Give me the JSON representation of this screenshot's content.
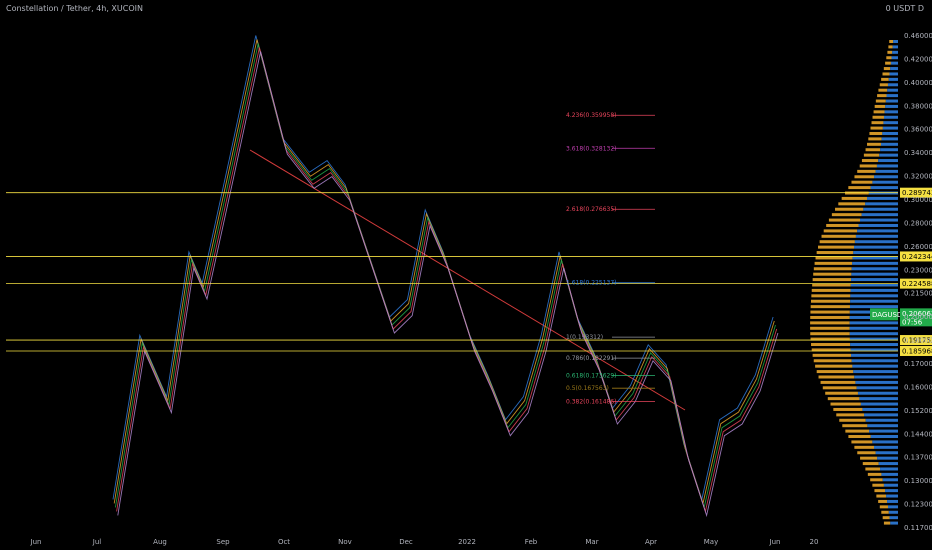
{
  "header": {
    "title": "Constellation / Tether, 4h, XUCOIN"
  },
  "price_axis_unit": "0 USDT D",
  "chart_data": {
    "type": "candlestick",
    "title": "Constellation / Tether, 4h, XUCOIN",
    "x_ticks": [
      "Jun",
      "Jul",
      "Aug",
      "Sep",
      "Oct",
      "Nov",
      "Dec",
      "2022",
      "Feb",
      "Mar",
      "Apr",
      "May",
      "Jun",
      "20"
    ],
    "y_ticks": [
      "0.460000",
      "0.420000",
      "0.400000",
      "0.380000",
      "0.360000",
      "0.340000",
      "0.320000",
      "0.300000",
      "0.280000",
      "0.260000",
      "0.230000",
      "0.215000",
      "0.200000",
      "0.180000",
      "0.170000",
      "0.160000",
      "0.152000",
      "0.144000",
      "0.137000",
      "0.130000",
      "0.123000",
      "0.117000"
    ],
    "y_range": [
      0.112,
      0.47
    ],
    "price_path": [
      [
        0.12,
        0.12
      ],
      [
        0.15,
        0.19
      ],
      [
        0.18,
        0.16
      ],
      [
        0.205,
        0.24
      ],
      [
        0.22,
        0.22
      ],
      [
        0.25,
        0.31
      ],
      [
        0.28,
        0.44
      ],
      [
        0.29,
        0.4
      ],
      [
        0.31,
        0.33
      ],
      [
        0.34,
        0.3
      ],
      [
        0.36,
        0.31
      ],
      [
        0.38,
        0.29
      ],
      [
        0.4,
        0.25
      ],
      [
        0.43,
        0.2
      ],
      [
        0.45,
        0.21
      ],
      [
        0.47,
        0.27
      ],
      [
        0.49,
        0.24
      ],
      [
        0.52,
        0.19
      ],
      [
        0.54,
        0.17
      ],
      [
        0.56,
        0.15
      ],
      [
        0.58,
        0.16
      ],
      [
        0.6,
        0.19
      ],
      [
        0.62,
        0.24
      ],
      [
        0.64,
        0.2
      ],
      [
        0.66,
        0.18
      ],
      [
        0.68,
        0.155
      ],
      [
        0.7,
        0.165
      ],
      [
        0.72,
        0.185
      ],
      [
        0.74,
        0.175
      ],
      [
        0.76,
        0.14
      ],
      [
        0.78,
        0.12
      ],
      [
        0.8,
        0.15
      ],
      [
        0.82,
        0.155
      ],
      [
        0.84,
        0.17
      ],
      [
        0.86,
        0.2
      ]
    ],
    "horizontal_levels": [
      {
        "price": 0.289743,
        "label": "0.289743",
        "color": "#f5e042"
      },
      {
        "price": 0.242344,
        "label": "0.242344",
        "color": "#f5e042"
      },
      {
        "price": 0.224588,
        "label": "0.224588",
        "color": "#f5e042"
      },
      {
        "price": 0.191752,
        "label": "0.191752",
        "color": "#f5e042"
      },
      {
        "price": 0.185968,
        "label": "0.185968",
        "color": "#f5e042"
      }
    ],
    "current_price": {
      "symbol": "DAGUSDT",
      "label": "0.206062",
      "countdown": "07:56",
      "price": 0.206062,
      "color": "#22ab4a"
    },
    "fib_levels": [
      {
        "label": "4.236(0.359958)",
        "price": 0.359958,
        "color": "#e8455c"
      },
      {
        "label": "3.618(0.328132)",
        "price": 0.328132,
        "color": "#c13fb0"
      },
      {
        "label": "2.618(0.276635)",
        "price": 0.276635,
        "color": "#e8455c"
      },
      {
        "label": "1.618(0.225137)",
        "price": 0.225137,
        "color": "#2f7dde"
      },
      {
        "label": "1(0.193312)",
        "price": 0.193312,
        "color": "#9598a1"
      },
      {
        "label": "0.786(0.182291)",
        "price": 0.182291,
        "color": "#9598a1"
      },
      {
        "label": "0.618(0.173629)",
        "price": 0.173629,
        "color": "#2bb673"
      },
      {
        "label": "0.5(0.167563)",
        "price": 0.167563,
        "color": "#9c7a1a"
      },
      {
        "label": "0.382(0.161486)",
        "price": 0.161486,
        "color": "#e8455c"
      }
    ]
  }
}
